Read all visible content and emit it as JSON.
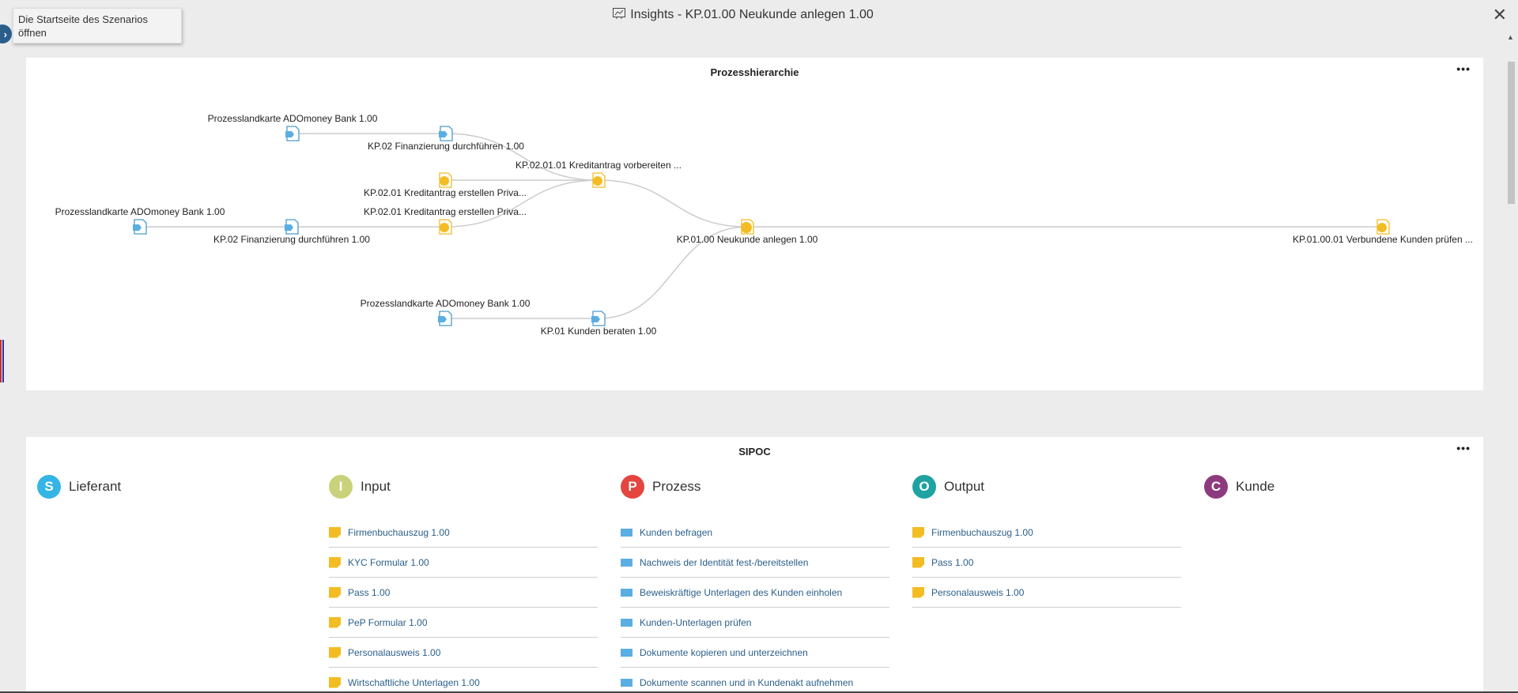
{
  "window": {
    "title": "Insights - KP.01.00 Neukunde anlegen 1.00",
    "close_icon": "close-icon"
  },
  "tooltip": {
    "text": "Die Startseite des Szenarios öffnen"
  },
  "hierarchy": {
    "title": "Prozesshierarchie",
    "more": "•••",
    "nodes": [
      {
        "id": "pl1",
        "kind": "landscape",
        "label": "Prozesslandkarte ADOmoney Bank 1.00"
      },
      {
        "id": "fin1",
        "kind": "landscape",
        "label": "KP.02 Finanzierung durchführen 1.00"
      },
      {
        "id": "kav",
        "kind": "process",
        "label": "KP.02.01.01 Kreditantrag vorbereiten ..."
      },
      {
        "id": "kep1",
        "kind": "process",
        "label": "KP.02.01 Kreditantrag erstellen Priva..."
      },
      {
        "id": "pl2",
        "kind": "landscape",
        "label": "Prozesslandkarte ADOmoney Bank 1.00"
      },
      {
        "id": "kep2",
        "kind": "process",
        "label": "KP.02.01 Kreditantrag erstellen Priva..."
      },
      {
        "id": "fin2",
        "kind": "landscape",
        "label": "KP.02 Finanzierung durchführen 1.00"
      },
      {
        "id": "main",
        "kind": "process",
        "label": "KP.01.00 Neukunde anlegen 1.00"
      },
      {
        "id": "vkp",
        "kind": "process",
        "label": "KP.01.00.01 Verbundene Kunden prüfen ..."
      },
      {
        "id": "pl3",
        "kind": "landscape",
        "label": "Prozesslandkarte ADOmoney Bank 1.00"
      },
      {
        "id": "kb",
        "kind": "landscape",
        "label": "KP.01 Kunden beraten 1.00"
      }
    ],
    "edges": [
      [
        "pl1",
        "fin1"
      ],
      [
        "fin1",
        "kav"
      ],
      [
        "kep1",
        "kav"
      ],
      [
        "kep2",
        "kav"
      ],
      [
        "pl2",
        "fin2"
      ],
      [
        "fin2",
        "kep2"
      ],
      [
        "kav",
        "main"
      ],
      [
        "main",
        "vkp"
      ],
      [
        "pl3",
        "kb"
      ],
      [
        "kb",
        "main"
      ]
    ],
    "colors": {
      "process": "#f3bc23",
      "landscape": "#5aaee2",
      "edge": "#cccccc"
    }
  },
  "sipoc": {
    "title": "SIPOC",
    "more": "•••",
    "columns": [
      {
        "letter": "S",
        "label": "Lieferant",
        "color": "#35b4e6",
        "items": []
      },
      {
        "letter": "I",
        "label": "Input",
        "color": "#c9d27a",
        "items": [
          "Firmenbuchauszug 1.00",
          "KYC Formular 1.00",
          "Pass 1.00",
          "PeP Formular 1.00",
          "Personalausweis 1.00",
          "Wirtschaftliche Unterlagen 1.00"
        ]
      },
      {
        "letter": "P",
        "label": "Prozess",
        "color": "#e5453f",
        "items": [
          "Kunden befragen",
          "Nachweis der Identität fest-/bereitstellen",
          "Beweiskräftige Unterlagen des Kunden einholen",
          "Kunden-Unterlagen prüfen",
          "Dokumente kopieren und unterzeichnen",
          "Dokumente scannen und in Kundenakt aufnehmen"
        ]
      },
      {
        "letter": "O",
        "label": "Output",
        "color": "#1fa2a2",
        "items": [
          "Firmenbuchauszug 1.00",
          "Pass 1.00",
          "Personalausweis 1.00"
        ]
      },
      {
        "letter": "C",
        "label": "Kunde",
        "color": "#8d3b7e",
        "items": []
      }
    ]
  }
}
